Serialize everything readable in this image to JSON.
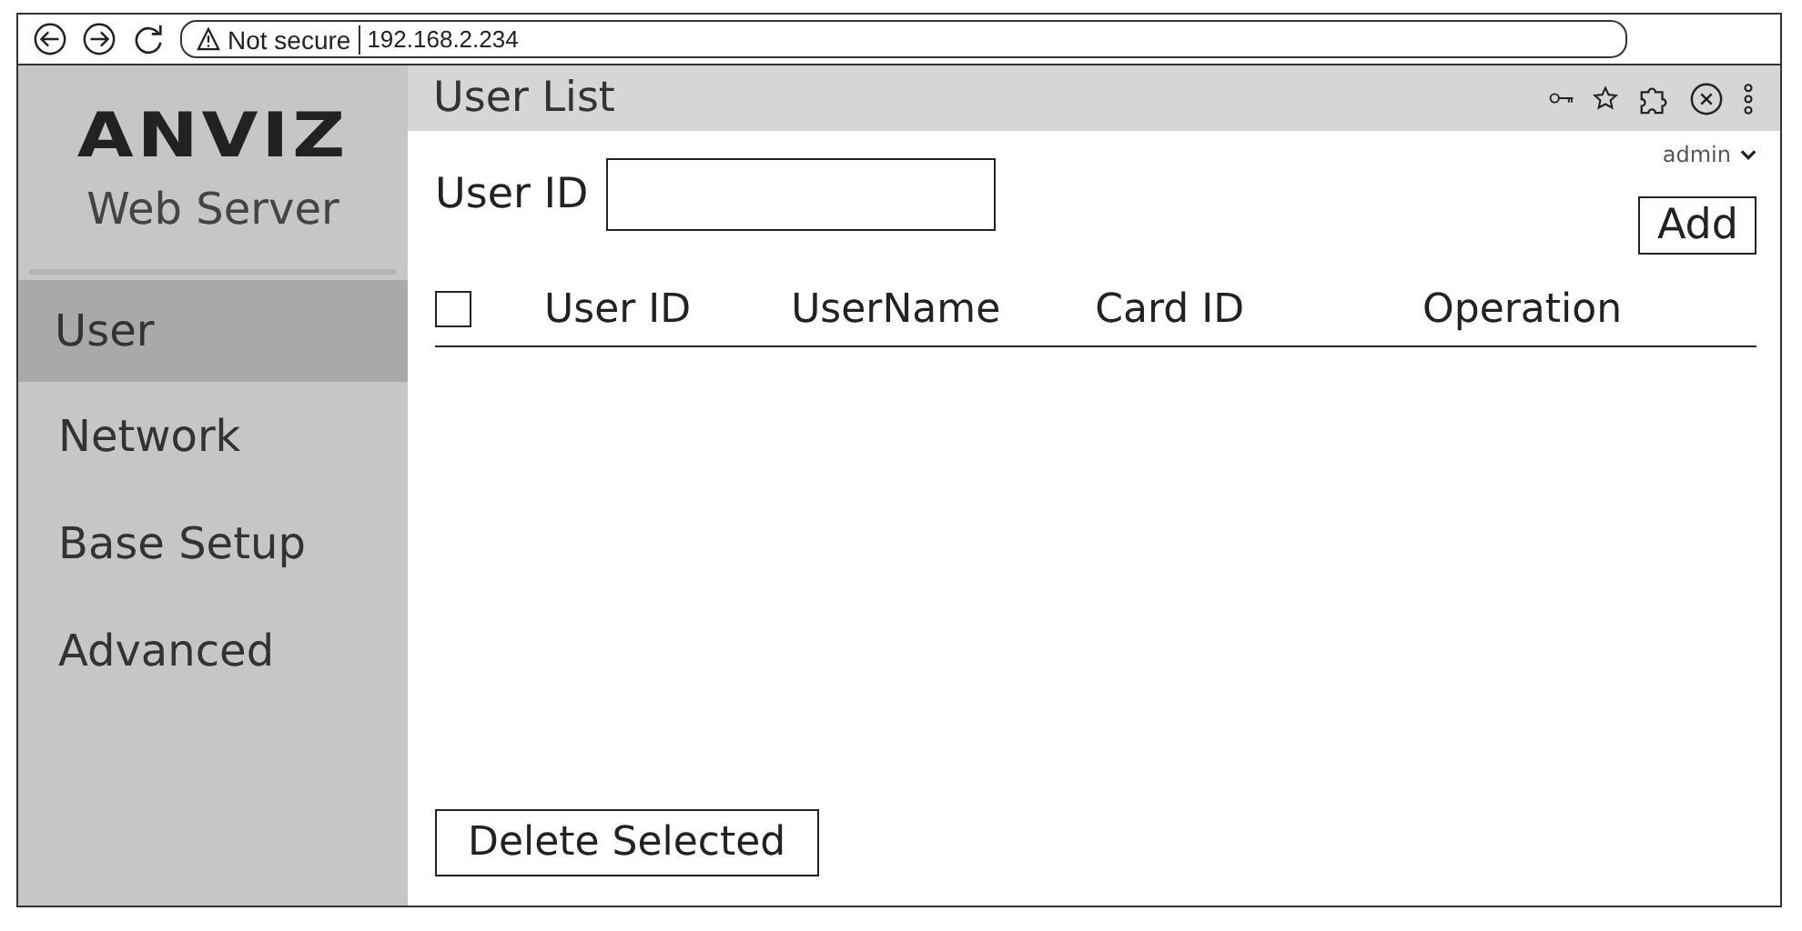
{
  "browser": {
    "security": "Not secure",
    "url": "192.168.2.234"
  },
  "sidebar": {
    "logo": "ANVIZ",
    "subtitle": "Web Server",
    "items": [
      {
        "label": "User",
        "selected": true
      },
      {
        "label": "Network",
        "selected": false
      },
      {
        "label": "Base Setup",
        "selected": false
      },
      {
        "label": "Advanced",
        "selected": false
      }
    ]
  },
  "header": {
    "title": "User List",
    "user": "admin"
  },
  "search": {
    "label": "User ID"
  },
  "add_button": "Add",
  "table": {
    "select_all": {
      "checked": false
    },
    "columns": [
      "User ID",
      "UserName",
      "Card ID",
      "Operation"
    ]
  },
  "delete_button": "Delete Selected"
}
